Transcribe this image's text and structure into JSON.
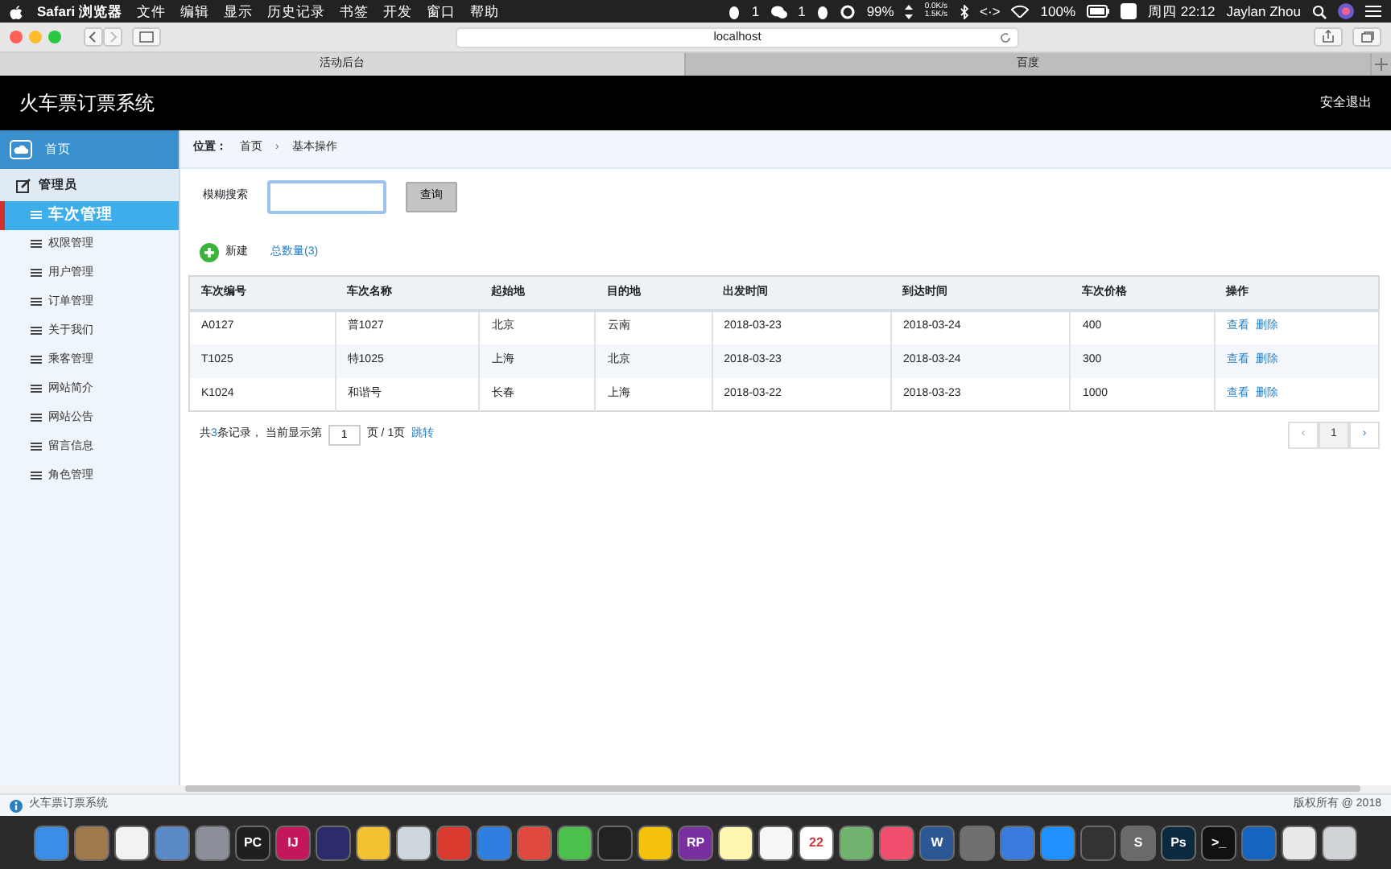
{
  "menu_bar": {
    "app": "Safari 浏览器",
    "menus": [
      "文件",
      "编辑",
      "显示",
      "历史记录",
      "书签",
      "开发",
      "窗口",
      "帮助"
    ],
    "status": [
      {
        "kind": "qq",
        "text": "1"
      },
      {
        "kind": "wechat",
        "text": "1"
      },
      {
        "kind": "qq"
      },
      {
        "kind": "ring",
        "text": "99%"
      },
      {
        "kind": "net",
        "up": "0.0K/s",
        "down": "1.5K/s"
      },
      {
        "kind": "bluetooth"
      },
      {
        "kind": "code",
        "text": "<·>"
      },
      {
        "kind": "wifi"
      },
      {
        "kind": "battery",
        "text": "100%"
      },
      {
        "kind": "s"
      },
      {
        "kind": "clock",
        "text": "周四 22:12"
      },
      {
        "kind": "user",
        "text": "Jaylan Zhou"
      },
      {
        "kind": "search"
      },
      {
        "kind": "siri"
      },
      {
        "kind": "list"
      }
    ]
  },
  "browser": {
    "url": "localhost",
    "tabs": [
      {
        "label": "活动后台",
        "selected": true
      },
      {
        "label": "百度",
        "selected": false
      }
    ]
  },
  "header": {
    "title": "火车票订票系统",
    "logout": "安全退出"
  },
  "sidebar": {
    "home": "首页",
    "group": "管理员",
    "items": [
      {
        "label": "车次管理",
        "selected": true
      },
      {
        "label": "权限管理",
        "selected": false
      },
      {
        "label": "用户管理",
        "selected": false
      },
      {
        "label": "订单管理",
        "selected": false
      },
      {
        "label": "关于我们",
        "selected": false
      },
      {
        "label": "乘客管理",
        "selected": false
      },
      {
        "label": "网站简介",
        "selected": false
      },
      {
        "label": "网站公告",
        "selected": false
      },
      {
        "label": "留言信息",
        "selected": false
      },
      {
        "label": "角色管理",
        "selected": false
      }
    ]
  },
  "breadcrumb": {
    "label": "位置：",
    "items": [
      "首页",
      "基本操作"
    ],
    "separator": "›"
  },
  "search": {
    "label": "模糊搜索",
    "button": "查询"
  },
  "toolbar": {
    "new": "新建",
    "total": "总数量(3)"
  },
  "table": {
    "columns": [
      "车次编号",
      "车次名称",
      "起始地",
      "目的地",
      "出发时间",
      "到达时间",
      "车次价格",
      "操作"
    ],
    "rows": [
      {
        "cells": [
          "A0127",
          "普1027",
          "北京",
          "云南",
          "2018-03-23",
          "2018-03-24",
          "400"
        ],
        "actions": [
          "查看",
          "删除"
        ]
      },
      {
        "cells": [
          "T1025",
          "特1025",
          "上海",
          "北京",
          "2018-03-23",
          "2018-03-24",
          "300"
        ],
        "actions": [
          "查看",
          "删除"
        ]
      },
      {
        "cells": [
          "K1024",
          "和谐号",
          "长春",
          "上海",
          "2018-03-22",
          "2018-03-23",
          "1000"
        ],
        "actions": [
          "查看",
          "删除"
        ]
      }
    ]
  },
  "pagination": {
    "pre": "共",
    "count": "3",
    "mid": "条记录，  当前显示第",
    "page": "1",
    "post": "页 / 1页",
    "jump": "跳转",
    "prev": "‹",
    "current": "1",
    "next": "›"
  },
  "status_bar": {
    "title": "火车票订票系统",
    "copyright": "版权所有 @ 2018"
  },
  "dock": [
    {
      "color": "#3a8ee6"
    },
    {
      "color": "#a07a4a"
    },
    {
      "color": "#f2f2f2"
    },
    {
      "color": "#5a8ac8"
    },
    {
      "color": "#8a8f99"
    },
    {
      "color": "#1f1f1f",
      "label": "PC"
    },
    {
      "color": "#c2185b",
      "label": "IJ"
    },
    {
      "color": "#2c2c6a"
    },
    {
      "color": "#f1c232"
    },
    {
      "color": "#cfd6de"
    },
    {
      "color": "#d83a2e"
    },
    {
      "color": "#2f7fe0"
    },
    {
      "color": "#e04a3e"
    },
    {
      "color": "#4cc04c"
    },
    {
      "color": "#222222"
    },
    {
      "color": "#f4c20d"
    },
    {
      "color": "#7a2fa0",
      "label": "RP"
    },
    {
      "color": "#fff6b0"
    },
    {
      "color": "#f7f7f7"
    },
    {
      "color": "#ffffff",
      "label": "22"
    },
    {
      "color": "#6fb36f"
    },
    {
      "color": "#f0506e"
    },
    {
      "color": "#2b5797",
      "label": "W"
    },
    {
      "color": "#707070"
    },
    {
      "color": "#3a7be0"
    },
    {
      "color": "#1e90ff"
    },
    {
      "color": "#333333"
    },
    {
      "color": "#6a6a6a",
      "label": "S"
    },
    {
      "color": "#0b2a3f",
      "label": "Ps"
    },
    {
      "color": "#111111",
      "label": ">_"
    },
    {
      "color": "#1565c0"
    },
    {
      "color": "#e8e8e8"
    },
    {
      "color": "#d0d4d8"
    }
  ]
}
